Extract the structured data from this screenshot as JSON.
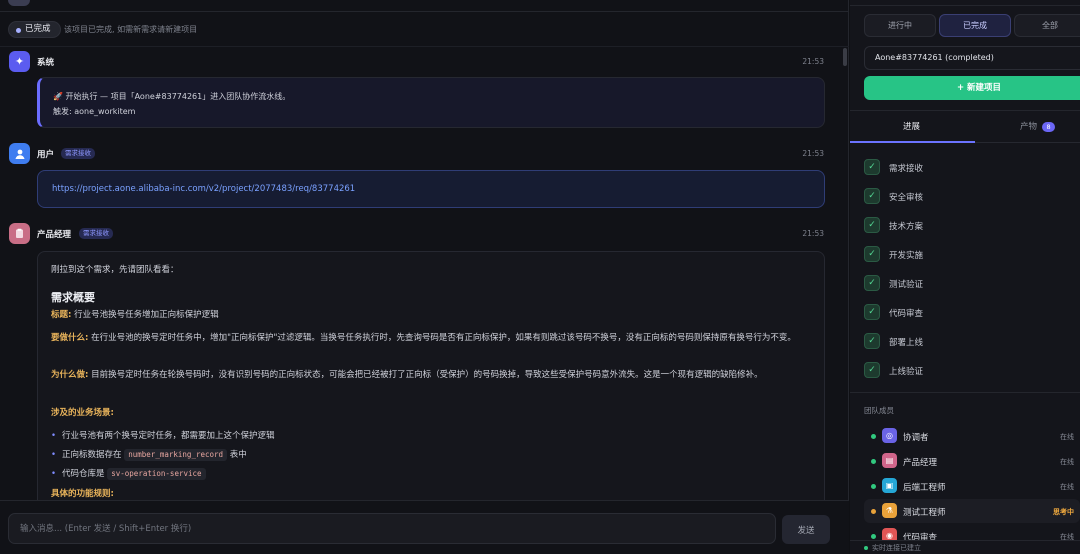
{
  "status": {
    "pill": "已完成",
    "note": "该项目已完成, 如需新需求请新建项目"
  },
  "messages": {
    "system": {
      "sender": "系统",
      "time": "21:53",
      "line1": "🚀 开始执行 — 项目「Aone#83774261」进入团队协作流水线。",
      "line2": "触发: aone_workitem"
    },
    "user": {
      "sender": "用户",
      "tag": "需求接收",
      "time": "21:53",
      "link": "https://project.aone.alibaba-inc.com/v2/project/2077483/req/83774261"
    },
    "pm": {
      "sender": "产品经理",
      "tag": "需求接收",
      "time": "21:53",
      "intro": "刚拉到这个需求，先请团队看看：",
      "heading": "需求概要",
      "title_label": "标题:",
      "title_text": " 行业号池换号任务增加正向标保护逻辑",
      "what_label": "要做什么:",
      "what_text": " 在行业号池的换号定时任务中，增加\"正向标保护\"过滤逻辑。当换号任务执行时，先查询号码是否有正向标保护，如果有则跳过该号码不换号，没有正向标的号码则保持原有换号行为不变。",
      "why_label": "为什么做:",
      "why_text": " 目前换号定时任务在轮换号码时，没有识别号码的正向标状态，可能会把已经被打了正向标（受保护）的号码换掉，导致这些受保护号码意外流失。这是一个现有逻辑的缺陷修补。",
      "scenes_label": "涉及的业务场景:",
      "bullet1": "行业号池有两个换号定时任务，都需要加上这个保护逻辑",
      "bullet2_pre": "正向标数据存在",
      "bullet2_code": "number_marking_record",
      "bullet2_post": "表中",
      "bullet3_pre": "代码仓库是",
      "bullet3_code": "sv-operation-service",
      "rules_label": "具体的功能规则:"
    }
  },
  "input": {
    "placeholder": "输入消息... (Enter 发送 / Shift+Enter 换行)",
    "send": "发送"
  },
  "sidebar": {
    "filters": [
      "进行中",
      "已完成",
      "全部"
    ],
    "project": "Aone#83774261 (completed)",
    "new_project": "+ 新建项目",
    "tabs": {
      "progress": "进展",
      "artifacts": "产物",
      "artifact_count": "8"
    },
    "steps": [
      "需求接收",
      "安全审核",
      "技术方案",
      "开发实施",
      "测试验证",
      "代码审查",
      "部署上线",
      "上线验证"
    ],
    "team_title": "团队成员",
    "members": [
      {
        "name": "协调者",
        "state": "在线"
      },
      {
        "name": "产品经理",
        "state": "在线"
      },
      {
        "name": "后端工程师",
        "state": "在线"
      },
      {
        "name": "测试工程师",
        "state": "思考中"
      },
      {
        "name": "代码审查",
        "state": "在线"
      }
    ],
    "connection": "实时连接已建立"
  }
}
